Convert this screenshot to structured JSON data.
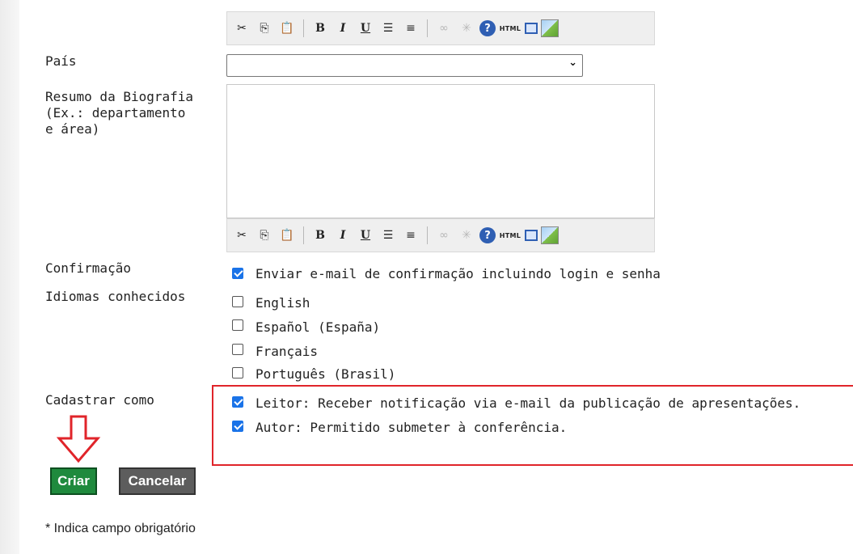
{
  "form": {
    "pais_label": "País",
    "pais_value": "",
    "bio_label": "Resumo da Biografia\n(Ex.: departamento\ne área)",
    "bio_value": "",
    "confirmacao_label": "Confirmação",
    "confirmacao_option": "Enviar e-mail de confirmação incluindo login e senha",
    "confirmacao_checked": true,
    "idiomas_label": "Idiomas conhecidos",
    "idiomas": [
      {
        "label": "English",
        "checked": false
      },
      {
        "label": "Español (España)",
        "checked": false
      },
      {
        "label": "Français",
        "checked": false
      },
      {
        "label": "Português (Brasil)",
        "checked": false
      }
    ],
    "cadastrar_label": "Cadastrar como",
    "cadastrar": [
      {
        "label": "Leitor: Receber notificação via e-mail da publicação de apresentações.",
        "checked": true
      },
      {
        "label": "Autor: Permitido submeter à conferência.",
        "checked": true
      }
    ]
  },
  "toolbar": {
    "buttons": [
      "cut",
      "copy",
      "paste",
      "bold",
      "italic",
      "underline",
      "bullet-list",
      "numbered-list",
      "link",
      "unlink",
      "help",
      "html",
      "fullscreen",
      "image"
    ],
    "bold_label": "B",
    "italic_label": "I",
    "underline_label": "U",
    "help_label": "?",
    "html_label": "HTML"
  },
  "buttons": {
    "create": "Criar",
    "cancel": "Cancelar"
  },
  "footnote": "* Indica campo obrigatório",
  "colors": {
    "accent": "#1a73e8",
    "create_button": "#1f8a3d",
    "cancel_button": "#5d5d5d",
    "highlight": "#e0242a"
  }
}
